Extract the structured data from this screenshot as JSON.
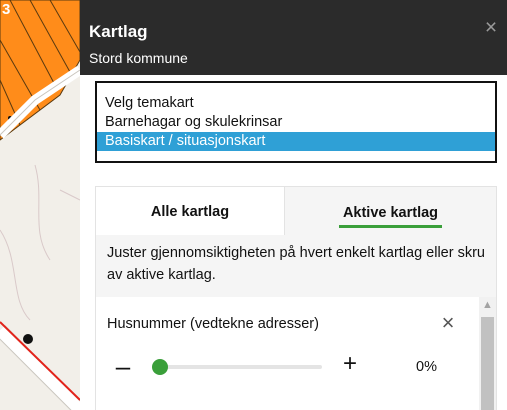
{
  "map": {
    "parcel_number": "3"
  },
  "panel": {
    "title": "Kartlag",
    "subtitle": "Stord kommune",
    "close_icon": "close-icon"
  },
  "theme_select": {
    "options": [
      "Velg temakart",
      "Barnehagar og skulekrinsar",
      "Basiskart / situasjonskart"
    ],
    "selected": "Basiskart / situasjonskart"
  },
  "tabs": {
    "all": "Alle kartlag",
    "active": "Aktive kartlag",
    "selected": "Aktive kartlag"
  },
  "info": {
    "text": "Juster gjennomsiktigheten på hvert enkelt kartlag eller skru av aktive kartlag."
  },
  "layers": [
    {
      "name": "Husnummer (vedtekne adresser)",
      "opacity_minus": "–",
      "opacity_plus": "+",
      "opacity_value": "0%",
      "opacity_fraction": 0.0
    }
  ],
  "colors": {
    "header_bg": "#2b2b2b",
    "selected_option": "#2fa0d6",
    "accent_green": "#3a9f3a",
    "map_orange": "#ff8c1a"
  }
}
